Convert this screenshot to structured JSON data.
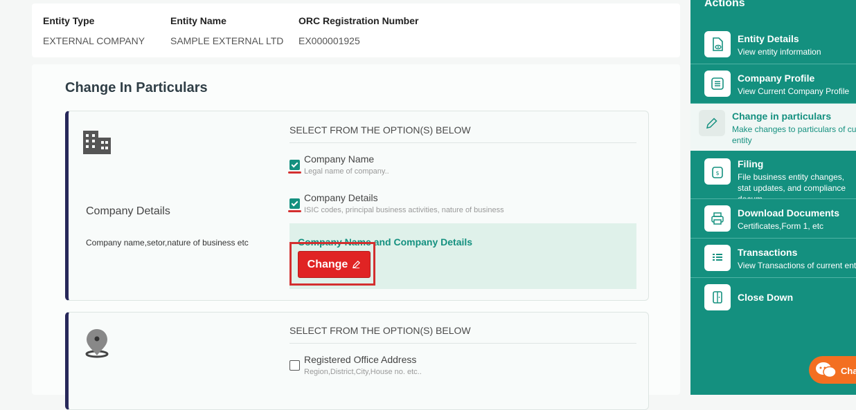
{
  "entity_info": {
    "type_label": "Entity Type",
    "type_value": "EXTERNAL COMPANY",
    "name_label": "Entity Name",
    "name_value": "SAMPLE EXTERNAL LTD",
    "orc_label": "ORC Registration Number",
    "orc_value": "EX000001925"
  },
  "page": {
    "title": "Change In Particulars"
  },
  "cards": [
    {
      "title": "Company Details",
      "description": "Company name,setor,nature of business etc",
      "options_header": "SELECT FROM THE OPTION(S) BELOW",
      "options": [
        {
          "label": "Company Name",
          "sub": "Legal name of company..",
          "checked": true
        },
        {
          "label": "Company Details",
          "sub": "ISIC codes, principal business activities, nature of business",
          "checked": true
        }
      ],
      "selected_summary": "Company Name and Company Details",
      "change_button": "Change"
    },
    {
      "options_header": "SELECT FROM THE OPTION(S) BELOW",
      "options": [
        {
          "label": "Registered Office Address",
          "sub": "Region,District,City,House no. etc..",
          "checked": false
        }
      ]
    }
  ],
  "sidebar": {
    "title": "Actions",
    "items": [
      {
        "title": "Entity Details",
        "sub": "View entity information",
        "icon": "document-eye-icon"
      },
      {
        "title": "Company Profile",
        "sub": "View Current Company Profile",
        "icon": "list-icon"
      },
      {
        "title": "Change in particulars",
        "sub": "Make changes to particulars of cu entity",
        "icon": "pencil-icon",
        "active": true
      },
      {
        "title": "Filing",
        "sub": "File business entity changes, stat updates, and compliance docum",
        "icon": "wallet-icon"
      },
      {
        "title": "Download Documents",
        "sub": "Certificates,Form 1, etc",
        "icon": "printer-icon"
      },
      {
        "title": "Transactions",
        "sub": "View Transactions of current enti",
        "icon": "transactions-icon"
      },
      {
        "title": "Close Down",
        "sub": "",
        "icon": "door-icon"
      }
    ]
  },
  "chat": {
    "label": "Cha"
  },
  "colors": {
    "primary": "#14907f",
    "danger": "#e02424",
    "navy": "#27285a"
  }
}
